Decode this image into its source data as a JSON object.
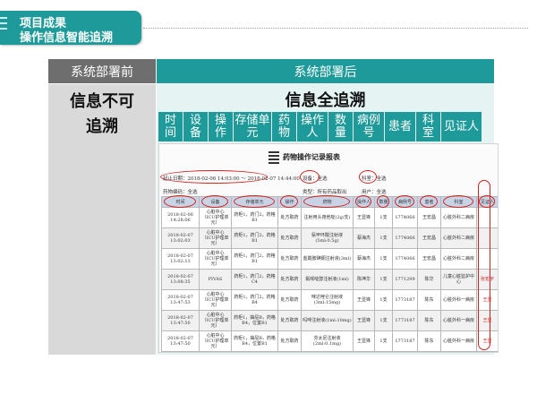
{
  "header": {
    "title": "项目成果",
    "subtitle": "操作信息智能追溯"
  },
  "before": {
    "heading": "系统部署前",
    "text_line1": "信息不可",
    "text_line2": "追溯"
  },
  "after": {
    "heading": "系统部署后",
    "text": "信息全追溯",
    "fields": [
      {
        "line1": "时",
        "line2": "间"
      },
      {
        "line1": "设",
        "line2": "备"
      },
      {
        "line1": "操",
        "line2": "作"
      },
      {
        "line1": "存储单",
        "line2": "元"
      },
      {
        "line1": "药",
        "line2": "物"
      },
      {
        "line1": "操作",
        "line2": "人"
      },
      {
        "line1": "数",
        "line2": "量"
      },
      {
        "line1": "病例",
        "line2": "号"
      },
      {
        "line1": "患者",
        "line2": ""
      },
      {
        "line1": "科",
        "line2": "室"
      },
      {
        "line1": "见证人",
        "line2": ""
      }
    ]
  },
  "report": {
    "title": "药物操作记录报表",
    "start_label": "起止日期：",
    "start_value": "2018-02-06 14:03:00 ～ 2018-02-07 14:44:00",
    "device_label": "设备：",
    "device_value": "全选",
    "cabinet_label": "科室：",
    "cabinet_value": "全选",
    "drug_label": "药物编码：",
    "drug_value": "全选",
    "type_label": "类型：",
    "type_value": "所有药品取出",
    "user_label": "用户：",
    "user_value": "全选",
    "columns": [
      "时间",
      "设备",
      "存储单元",
      "操作",
      "药物",
      "操作人",
      "数量",
      "病例号",
      "患者",
      "科室",
      "见证人"
    ],
    "rows": [
      [
        "2018-02-06 14:28:06",
        "心脏中心（ICU护理单元）",
        "药柜1，药门2，药格B1",
        "处方取药",
        "注射用头孢他啶(2g/支)",
        "王显锋",
        "1支",
        "1774066",
        "王宏昌",
        "心脏外科二病房",
        ""
      ],
      [
        "2018-02-07 13:02:03",
        "心脏中心（ICU护理单元）",
        "药柜1，药门2，药格B1",
        "处方取药",
        "氨甲环酸注射液(5ml:0.5g)",
        "蔡海杰",
        "1支",
        "1774066",
        "王宏昌",
        "心脏外科二病房",
        ""
      ],
      [
        "2018-02-07 13:02:13",
        "心脏中心（ICU护理单元）",
        "药柜1，药门2，药格B1",
        "处方取药",
        "盐酸胺碘酮注射液(3ml)",
        "蔡海杰",
        "1支",
        "1774066",
        "王宏昌",
        "心脏外科二病房",
        ""
      ],
      [
        "2018-02-07 13:08:35",
        "PIVAS",
        "药柜1，药门2，药格C4",
        "处方取药",
        "氟哌啶醇注射液(1ml)",
        "陈坤华",
        "1支",
        "1771299",
        "陈华",
        "儿童心脏监护中心",
        "张宏宇"
      ],
      [
        "2018-02-07 13:47:53",
        "心脏中心（ICU护理单元）",
        "药柜1，药门2，药格B4",
        "处方取药",
        "咪达唑仑注射液(3ml:15mg)",
        "王显锋",
        "1支",
        "1773187",
        "陈东",
        "心脏外科一病房",
        "王显"
      ],
      [
        "2018-02-07 13:47:50",
        "心脏中心（ICU护理单元）",
        "药柜1，抽屉B，药格B4，位置B1",
        "处方取药",
        "吗啡注射液(1ml:10mg)",
        "王显锋",
        "1支",
        "1773187",
        "陈东",
        "心脏外科一病房",
        "王显"
      ],
      [
        "2018-02-07 13:47:50",
        "心脏中心（ICU护理单元）",
        "药柜1，抽屉B，药格B4，位置B1",
        "处方取药",
        "芬太尼注射液(2ml:0.1mg)",
        "王显锋",
        "1支",
        "1773187",
        "陈东",
        "心脏外科一病房",
        "王显"
      ]
    ]
  }
}
